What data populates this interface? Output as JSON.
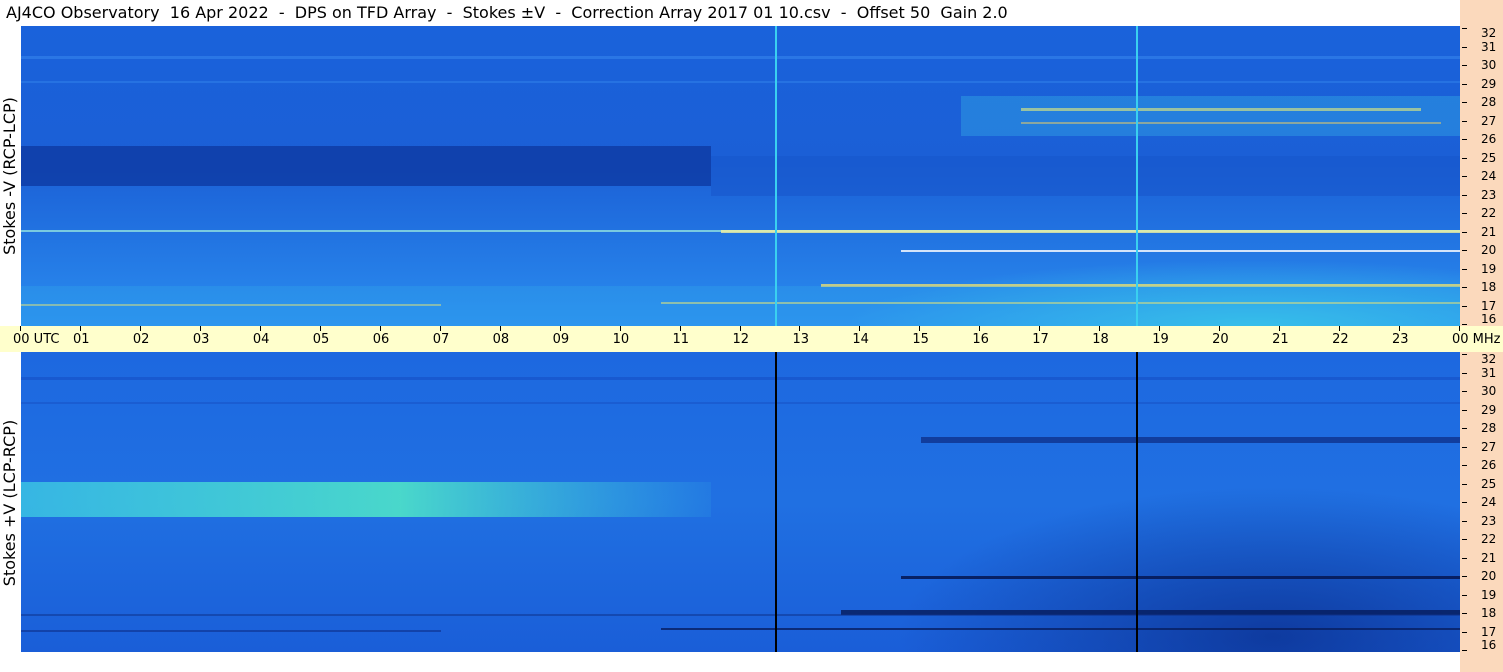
{
  "header": {
    "title": "AJ4CO Observatory  16 Apr 2022  -  DPS on TFD Array  -  Stokes ±V  -  Correction Array 2017 01 10.csv  -  Offset 50  Gain 2.0"
  },
  "panels": {
    "top": {
      "label": "Stokes -V (RCP-LCP)"
    },
    "bottom": {
      "label": "Stokes +V (LCP-RCP)"
    }
  },
  "time_axis": {
    "labels": [
      "00 UTC",
      "01",
      "02",
      "03",
      "04",
      "05",
      "06",
      "07",
      "08",
      "09",
      "10",
      "11",
      "12",
      "13",
      "14",
      "15",
      "16",
      "17",
      "18",
      "19",
      "20",
      "21",
      "22",
      "23",
      "00 MHz"
    ]
  },
  "freq_axis": {
    "labels": [
      "32",
      "31",
      "30",
      "29",
      "28",
      "27",
      "26",
      "25",
      "24",
      "23",
      "22",
      "21",
      "20",
      "19",
      "18",
      "17",
      "16"
    ]
  },
  "colors": {
    "background_blue": "#1e6fe8",
    "dark_band": "#0d3aa8",
    "bright_band": "#39d8e6",
    "time_bar": "#ffffcc",
    "freq_strip": "#fbd9bc"
  }
}
